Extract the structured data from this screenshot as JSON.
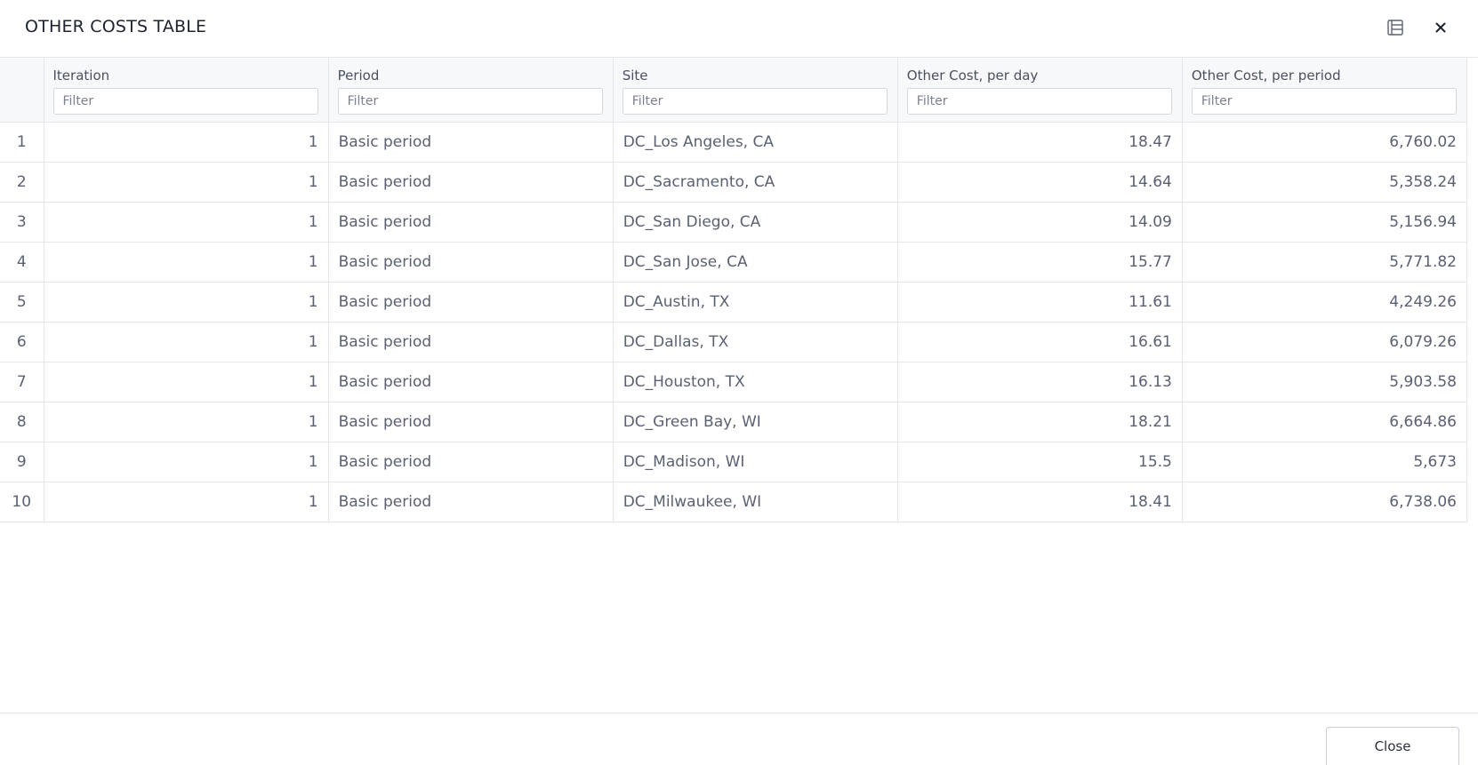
{
  "dialog": {
    "title": "OTHER COSTS TABLE",
    "close_label": "Close"
  },
  "table": {
    "columns": [
      {
        "label": "Iteration",
        "placeholder": "Filter"
      },
      {
        "label": "Period",
        "placeholder": "Filter"
      },
      {
        "label": "Site",
        "placeholder": "Filter"
      },
      {
        "label": "Other Cost, per day",
        "placeholder": "Filter"
      },
      {
        "label": "Other Cost, per period",
        "placeholder": "Filter"
      }
    ],
    "rows": [
      {
        "num": "1",
        "iteration": "1",
        "period": "Basic period",
        "site": "DC_Los Angeles, CA",
        "per_day": "18.47",
        "per_period": "6,760.02"
      },
      {
        "num": "2",
        "iteration": "1",
        "period": "Basic period",
        "site": "DC_Sacramento, CA",
        "per_day": "14.64",
        "per_period": "5,358.24"
      },
      {
        "num": "3",
        "iteration": "1",
        "period": "Basic period",
        "site": "DC_San Diego, CA",
        "per_day": "14.09",
        "per_period": "5,156.94"
      },
      {
        "num": "4",
        "iteration": "1",
        "period": "Basic period",
        "site": "DC_San Jose, CA",
        "per_day": "15.77",
        "per_period": "5,771.82"
      },
      {
        "num": "5",
        "iteration": "1",
        "period": "Basic period",
        "site": "DC_Austin, TX",
        "per_day": "11.61",
        "per_period": "4,249.26"
      },
      {
        "num": "6",
        "iteration": "1",
        "period": "Basic period",
        "site": "DC_Dallas, TX",
        "per_day": "16.61",
        "per_period": "6,079.26"
      },
      {
        "num": "7",
        "iteration": "1",
        "period": "Basic period",
        "site": "DC_Houston, TX",
        "per_day": "16.13",
        "per_period": "5,903.58"
      },
      {
        "num": "8",
        "iteration": "1",
        "period": "Basic period",
        "site": "DC_Green Bay, WI",
        "per_day": "18.21",
        "per_period": "6,664.86"
      },
      {
        "num": "9",
        "iteration": "1",
        "period": "Basic period",
        "site": "DC_Madison, WI",
        "per_day": "15.5",
        "per_period": "5,673"
      },
      {
        "num": "10",
        "iteration": "1",
        "period": "Basic period",
        "site": "DC_Milwaukee, WI",
        "per_day": "18.41",
        "per_period": "6,738.06"
      }
    ]
  },
  "icons": {
    "columns_toggle": "columns-icon",
    "close": "close-icon"
  }
}
